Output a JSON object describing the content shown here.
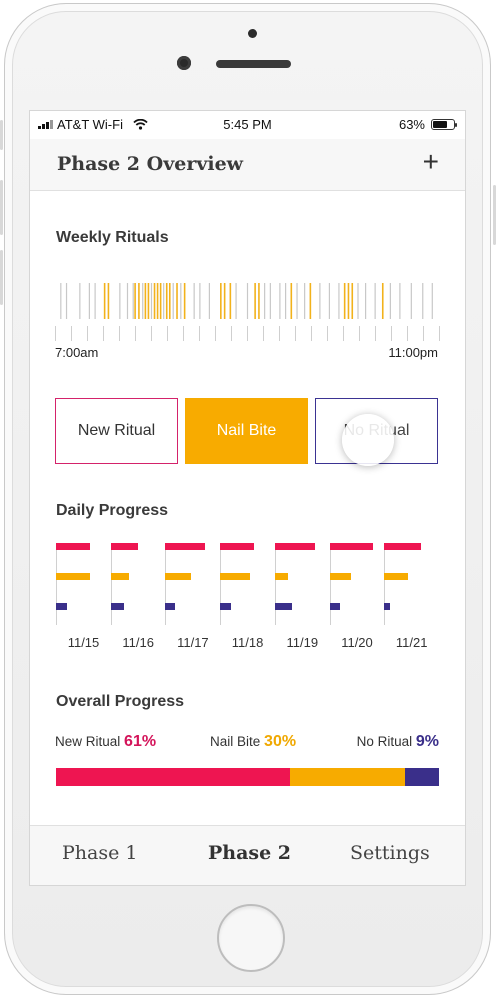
{
  "status_bar": {
    "carrier": "AT&T Wi-Fi",
    "time": "5:45 PM",
    "battery": "63%",
    "battery_level": 0.63
  },
  "header": {
    "title": "Phase 2 Overview",
    "add_label": "+"
  },
  "weekly": {
    "title": "Weekly Rituals",
    "start_label": "7:00am",
    "end_label": "11:00pm",
    "colors": {
      "gray": "#c8c8c8",
      "orange": "#f2b21b"
    },
    "tick_count": 24,
    "marks": [
      {
        "t": 0.01,
        "c": "gray"
      },
      {
        "t": 0.025,
        "c": "gray"
      },
      {
        "t": 0.06,
        "c": "gray"
      },
      {
        "t": 0.085,
        "c": "gray"
      },
      {
        "t": 0.1,
        "c": "gray"
      },
      {
        "t": 0.125,
        "c": "orange"
      },
      {
        "t": 0.135,
        "c": "orange"
      },
      {
        "t": 0.165,
        "c": "gray"
      },
      {
        "t": 0.185,
        "c": "gray"
      },
      {
        "t": 0.2,
        "c": "gray"
      },
      {
        "t": 0.205,
        "c": "orange"
      },
      {
        "t": 0.215,
        "c": "orange"
      },
      {
        "t": 0.225,
        "c": "gray"
      },
      {
        "t": 0.232,
        "c": "orange"
      },
      {
        "t": 0.24,
        "c": "orange"
      },
      {
        "t": 0.248,
        "c": "gray"
      },
      {
        "t": 0.256,
        "c": "orange"
      },
      {
        "t": 0.264,
        "c": "orange"
      },
      {
        "t": 0.272,
        "c": "orange"
      },
      {
        "t": 0.28,
        "c": "gray"
      },
      {
        "t": 0.288,
        "c": "orange"
      },
      {
        "t": 0.296,
        "c": "orange"
      },
      {
        "t": 0.305,
        "c": "gray"
      },
      {
        "t": 0.315,
        "c": "orange"
      },
      {
        "t": 0.325,
        "c": "gray"
      },
      {
        "t": 0.335,
        "c": "orange"
      },
      {
        "t": 0.36,
        "c": "gray"
      },
      {
        "t": 0.375,
        "c": "gray"
      },
      {
        "t": 0.4,
        "c": "gray"
      },
      {
        "t": 0.43,
        "c": "orange"
      },
      {
        "t": 0.44,
        "c": "orange"
      },
      {
        "t": 0.455,
        "c": "orange"
      },
      {
        "t": 0.47,
        "c": "gray"
      },
      {
        "t": 0.5,
        "c": "gray"
      },
      {
        "t": 0.52,
        "c": "orange"
      },
      {
        "t": 0.53,
        "c": "orange"
      },
      {
        "t": 0.545,
        "c": "gray"
      },
      {
        "t": 0.56,
        "c": "gray"
      },
      {
        "t": 0.585,
        "c": "gray"
      },
      {
        "t": 0.6,
        "c": "gray"
      },
      {
        "t": 0.615,
        "c": "orange"
      },
      {
        "t": 0.63,
        "c": "gray"
      },
      {
        "t": 0.65,
        "c": "gray"
      },
      {
        "t": 0.665,
        "c": "orange"
      },
      {
        "t": 0.69,
        "c": "gray"
      },
      {
        "t": 0.715,
        "c": "gray"
      },
      {
        "t": 0.74,
        "c": "gray"
      },
      {
        "t": 0.755,
        "c": "orange"
      },
      {
        "t": 0.765,
        "c": "orange"
      },
      {
        "t": 0.775,
        "c": "orange"
      },
      {
        "t": 0.79,
        "c": "gray"
      },
      {
        "t": 0.81,
        "c": "gray"
      },
      {
        "t": 0.835,
        "c": "gray"
      },
      {
        "t": 0.855,
        "c": "orange"
      },
      {
        "t": 0.875,
        "c": "gray"
      },
      {
        "t": 0.9,
        "c": "gray"
      },
      {
        "t": 0.93,
        "c": "gray"
      },
      {
        "t": 0.96,
        "c": "gray"
      },
      {
        "t": 0.985,
        "c": "gray"
      }
    ]
  },
  "ritual_buttons": {
    "new": "New Ritual",
    "nail": "Nail Bite",
    "no": "No Ritual"
  },
  "daily": {
    "title": "Daily Progress",
    "colors": {
      "new": "#ee1551",
      "nail": "#f7ab00",
      "no": "#3a2f8a"
    },
    "days": [
      {
        "date": "11/15",
        "new": 0.62,
        "nail": 0.62,
        "no": 0.2
      },
      {
        "date": "11/16",
        "new": 0.5,
        "nail": 0.33,
        "no": 0.25
      },
      {
        "date": "11/17",
        "new": 0.73,
        "nail": 0.47,
        "no": 0.18
      },
      {
        "date": "11/18",
        "new": 0.62,
        "nail": 0.55,
        "no": 0.2
      },
      {
        "date": "11/19",
        "new": 0.73,
        "nail": 0.25,
        "no": 0.31
      },
      {
        "date": "11/20",
        "new": 0.8,
        "nail": 0.4,
        "no": 0.2
      },
      {
        "date": "11/21",
        "new": 0.67,
        "nail": 0.44,
        "no": 0.1
      }
    ]
  },
  "overall": {
    "title": "Overall Progress",
    "new_label": "New Ritual",
    "new_pct": "61%",
    "new_value": 61,
    "nail_label": "Nail Bite",
    "nail_pct": "30%",
    "nail_value": 30,
    "no_label": "No Ritual",
    "no_pct": "9%",
    "no_value": 9,
    "colors": {
      "new": "#ee1551",
      "nail": "#f7ab00",
      "no": "#3a2f8a"
    }
  },
  "tabs": {
    "phase1": "Phase 1",
    "phase2": "Phase 2",
    "settings": "Settings"
  }
}
